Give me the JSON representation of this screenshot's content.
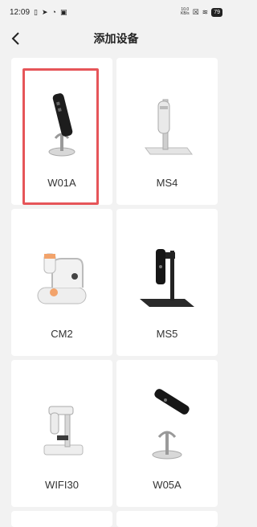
{
  "status_bar": {
    "time": "12:09",
    "network_speed": "10.0",
    "network_unit": "KB/s",
    "battery": "79"
  },
  "header": {
    "title": "添加设备"
  },
  "devices": [
    {
      "name": "W01A",
      "selected": true
    },
    {
      "name": "MS4",
      "selected": false
    },
    {
      "name": "CM2",
      "selected": false
    },
    {
      "name": "MS5",
      "selected": false
    },
    {
      "name": "WIFI30",
      "selected": false
    },
    {
      "name": "W05A",
      "selected": false
    }
  ],
  "colors": {
    "background": "#f2f2f2",
    "card": "#ffffff",
    "selection_border": "#e65559"
  }
}
